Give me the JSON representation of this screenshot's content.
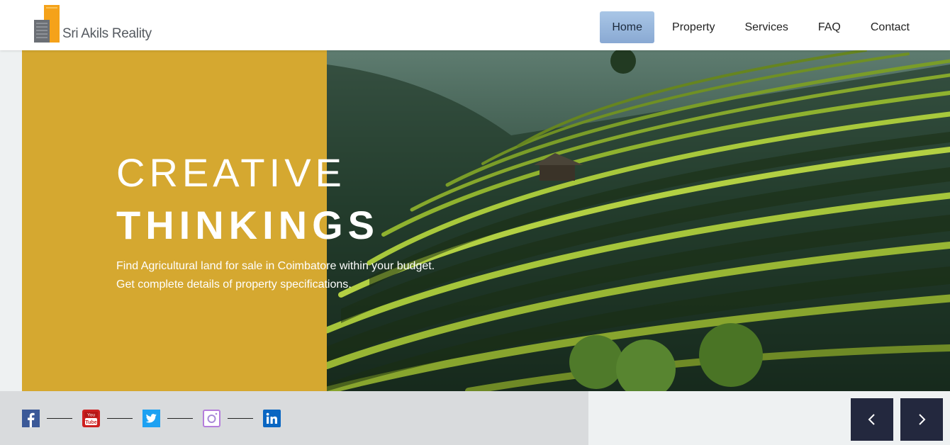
{
  "brand": {
    "name": "Sri Akils Reality"
  },
  "nav": {
    "items": [
      {
        "label": "Home",
        "active": true
      },
      {
        "label": "Property",
        "active": false
      },
      {
        "label": "Services",
        "active": false
      },
      {
        "label": "FAQ",
        "active": false
      },
      {
        "label": "Contact",
        "active": false
      }
    ]
  },
  "hero": {
    "title_line1": "CREATIVE",
    "title_line2": "THINKINGS",
    "description_line1": "Find Agricultural land for sale in Coimbatore within your budget.",
    "description_line2": "Get complete details of property specifications."
  },
  "social": [
    {
      "icon": "facebook-icon",
      "color": "#3b5998"
    },
    {
      "icon": "youtube-icon",
      "color": "#cd201f"
    },
    {
      "icon": "twitter-icon",
      "color": "#1da1f2"
    },
    {
      "icon": "instagram-icon",
      "color": "#b57edc"
    },
    {
      "icon": "linkedin-icon",
      "color": "#0a66c2"
    }
  ],
  "slider": {
    "prev_icon": "chevron-left-icon",
    "next_icon": "chevron-right-icon"
  },
  "colors": {
    "accent_gold": "#d5a830",
    "nav_active": "#9ab7de",
    "arrow_bg": "#23283e"
  }
}
